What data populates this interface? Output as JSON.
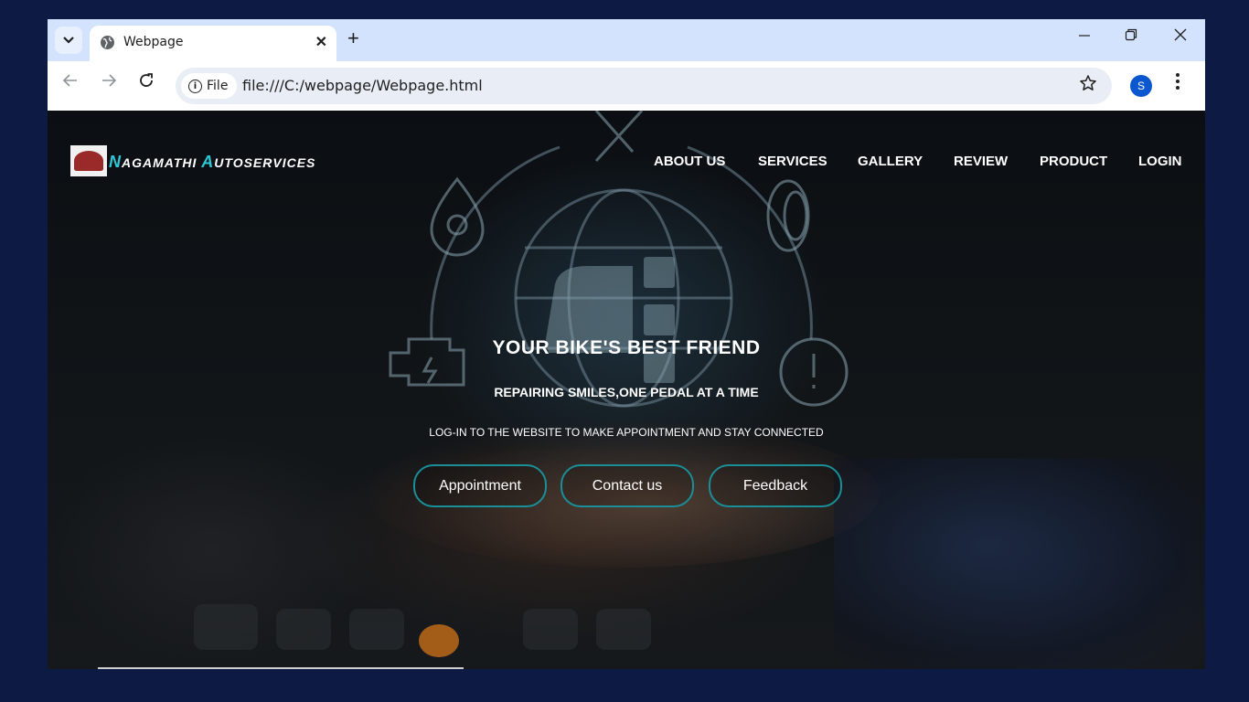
{
  "browser": {
    "tab_title": "Webpage",
    "tab_close": "✕",
    "new_tab": "+",
    "site_chip": "File",
    "url": "file:///C:/webpage/Webpage.html",
    "profile_initial": "S"
  },
  "site": {
    "brand": {
      "word1_cap": "N",
      "word1_rest": "AGAMATHI ",
      "word2_cap": "A",
      "word2_rest": "UTOSERVICES"
    },
    "nav": [
      "ABOUT US",
      "SERVICES",
      "GALLERY",
      "REVIEW",
      "PRODUCT",
      "LOGIN"
    ],
    "hero": {
      "title": "YOUR BIKE'S BEST FRIEND",
      "subtitle": "REPAIRING SMILES,ONE PEDAL AT A TIME",
      "small": "LOG-IN TO THE WEBSITE TO MAKE APPOINTMENT AND STAY CONNECTED"
    },
    "buttons": [
      "Appointment",
      "Contact us",
      "Feedback"
    ]
  },
  "colors": {
    "accent": "#2ec7d6",
    "button_border": "#1a8f97",
    "desktop_bg": "#0d1b44"
  }
}
